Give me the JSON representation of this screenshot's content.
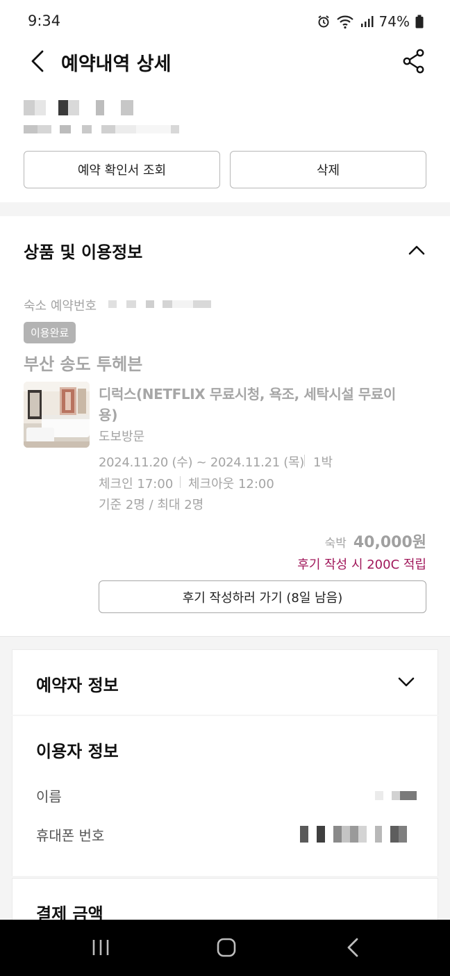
{
  "status_bar": {
    "time": "9:34",
    "battery_percent": "74%",
    "icons": [
      "alarm-icon",
      "wifi-icon",
      "signal-icon",
      "battery-icon"
    ]
  },
  "header": {
    "title": "예약내역 상세",
    "back_icon": "chevron-left-icon",
    "share_icon": "share-icon"
  },
  "actions": {
    "confirm_label": "예약 확인서 조회",
    "delete_label": "삭제"
  },
  "product_section": {
    "title": "상품 및 이용정보",
    "reservation_no_label": "숙소 예약번호",
    "status_badge": "이용완료",
    "hotel_name": "부산 송도 투헤븐",
    "room_name_line1": "디럭스(NETFLIX 무료시청, 욕조, 세탁시설 무료이",
    "room_name_line2": "용)",
    "visit_type": "도보방문",
    "date_range": "2024.11.20 (수) ~ 2024.11.21 (목)",
    "nights": "1박",
    "checkin": "체크인 17:00",
    "checkout": "체크아웃 12:00",
    "occupancy": "기준 2명 / 최대 2명",
    "price_label": "숙박",
    "price": "40,000원",
    "review_reward": "후기 작성 시 200C 적립",
    "review_button": "후기 작성하러 가기 (8일 남음)"
  },
  "booker_section": {
    "title": "예약자 정보"
  },
  "user_section": {
    "title": "이용자 정보",
    "name_label": "이름",
    "phone_label": "휴대폰 번호"
  },
  "payment_section": {
    "title": "결제 금액"
  },
  "colors": {
    "accent_magenta": "#a0175a",
    "badge_grey": "#b3b3b3",
    "muted_text": "#9b9b9b"
  }
}
